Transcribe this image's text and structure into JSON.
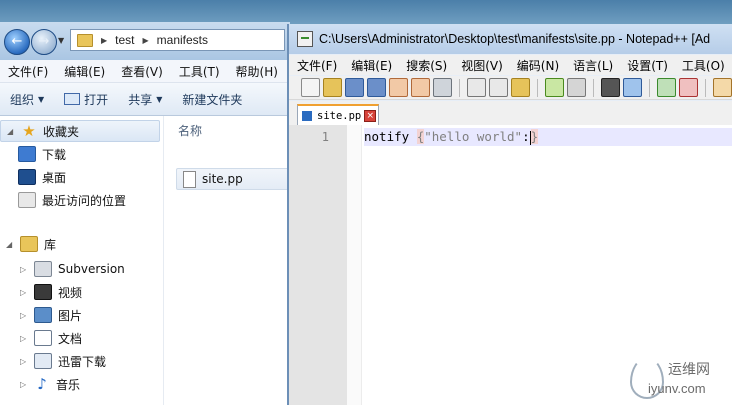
{
  "explorer": {
    "breadcrumb": [
      "test",
      "manifests"
    ],
    "menu": [
      "文件(F)",
      "编辑(E)",
      "查看(V)",
      "工具(T)",
      "帮助(H)"
    ],
    "toolbar": {
      "organize": "组织",
      "open": "打开",
      "share": "共享",
      "new_folder": "新建文件夹"
    },
    "nav": {
      "favorites": "收藏夹",
      "downloads": "下载",
      "desktop": "桌面",
      "recent": "最近访问的位置",
      "libraries": "库",
      "subversion": "Subversion",
      "videos": "视频",
      "pictures": "图片",
      "documents": "文档",
      "xunlei": "迅雷下载",
      "music": "音乐"
    },
    "column_name": "名称",
    "file": "site.pp"
  },
  "notepad": {
    "title": "C:\\Users\\Administrator\\Desktop\\test\\manifests\\site.pp - Notepad++ [Ad",
    "menu": [
      "文件(F)",
      "编辑(E)",
      "搜索(S)",
      "视图(V)",
      "编码(N)",
      "语言(L)",
      "设置(T)",
      "工具(O)"
    ],
    "tab_label": "site.pp",
    "line_number": "1",
    "code": {
      "keyword": "notify",
      "open_brace": "{",
      "string": "\"hello world\"",
      "colon": ":",
      "close_brace": "}"
    }
  },
  "watermark": {
    "cn": "运维网",
    "domain": "iyunv.com"
  }
}
